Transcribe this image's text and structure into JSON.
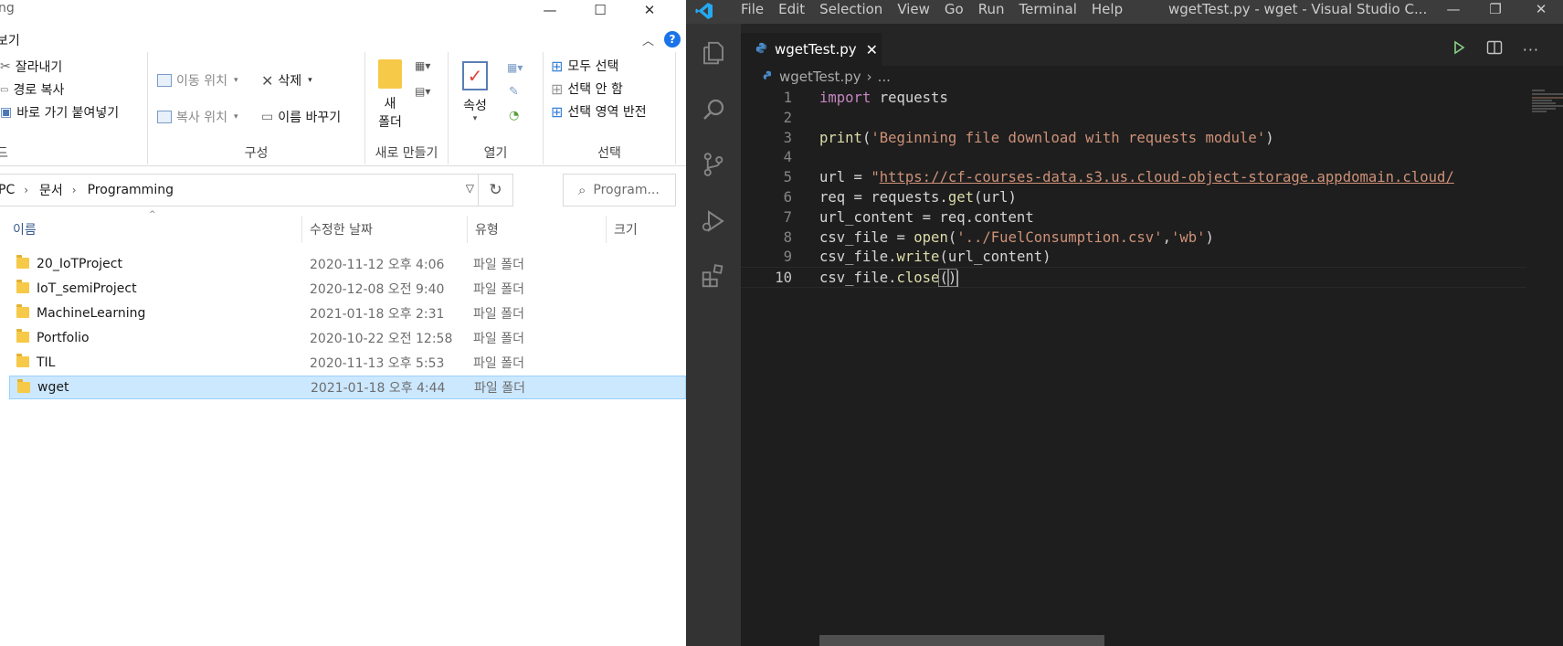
{
  "explorer": {
    "title_partial": "ng",
    "menu_tab_partial": "보기",
    "ribbon": {
      "clipboard": {
        "cut": "잘라내기",
        "copy_path": "경로 복사",
        "paste_shortcut": "바로 가기 붙여넣기",
        "group_label_partial": "드"
      },
      "organize": {
        "move_to": "이동 위치",
        "copy_to": "복사 위치",
        "delete": "삭제",
        "rename": "이름 바꾸기",
        "label": "구성"
      },
      "new": {
        "new_folder_line1": "새",
        "new_folder_line2": "폴더",
        "label": "새로 만들기"
      },
      "open": {
        "properties": "속성",
        "label": "열기"
      },
      "select": {
        "select_all": "모두 선택",
        "select_none": "선택 안 함",
        "invert_selection": "선택 영역 반전",
        "label": "선택"
      }
    },
    "address": {
      "segments": [
        "PC",
        "문서",
        "Programming"
      ],
      "search_placeholder": "Program..."
    },
    "columns": {
      "name": "이름",
      "date": "수정한 날짜",
      "type": "유형",
      "size": "크기"
    },
    "files": [
      {
        "name": "20_IoTProject",
        "date": "2020-11-12 오후 4:06",
        "type": "파일 폴더"
      },
      {
        "name": "IoT_semiProject",
        "date": "2020-12-08 오전 9:40",
        "type": "파일 폴더"
      },
      {
        "name": "MachineLearning",
        "date": "2021-01-18 오후 2:31",
        "type": "파일 폴더"
      },
      {
        "name": "Portfolio",
        "date": "2020-10-22 오전 12:58",
        "type": "파일 폴더"
      },
      {
        "name": "TIL",
        "date": "2020-11-13 오후 5:53",
        "type": "파일 폴더"
      },
      {
        "name": "wget",
        "date": "2021-01-18 오후 4:44",
        "type": "파일 폴더",
        "selected": true
      }
    ]
  },
  "vscode": {
    "menu": [
      "File",
      "Edit",
      "Selection",
      "View",
      "Go",
      "Run",
      "Terminal",
      "Help"
    ],
    "window_title": "wgetTest.py - wget - Visual Studio C...",
    "tab_label": "wgetTest.py",
    "breadcrumb_file": "wgetTest.py",
    "breadcrumb_more": "...",
    "lines": [
      "import requests",
      "",
      "print('Beginning file download with requests module')",
      "",
      "url = \"https://cf-courses-data.s3.us.cloud-object-storage.appdomain.cloud/",
      "req = requests.get(url)",
      "url_content = req.content",
      "csv_file = open('../FuelConsumption.csv','wb')",
      "csv_file.write(url_content)",
      "csv_file.close()"
    ],
    "line_numbers": [
      "1",
      "2",
      "3",
      "4",
      "5",
      "6",
      "7",
      "8",
      "9",
      "10"
    ]
  }
}
